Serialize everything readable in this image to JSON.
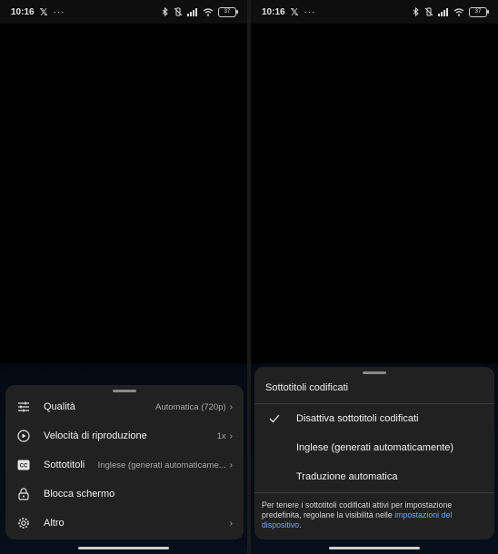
{
  "status": {
    "time": "10:16",
    "x_glyph": "𝕏",
    "dots": "···",
    "battery": "37"
  },
  "left_menu": {
    "items": [
      {
        "label": "Qualità",
        "value": "Automatica (720p)",
        "chevron": "›",
        "icon": "tune-icon"
      },
      {
        "label": "Velocità di riproduzione",
        "value": "1x",
        "chevron": "›",
        "icon": "playback-speed-icon"
      },
      {
        "label": "Sottotitoli",
        "value": "Inglese (generati automaticame...",
        "chevron": "›",
        "icon": "closed-captions-icon"
      },
      {
        "label": "Blocca schermo",
        "value": "",
        "chevron": "",
        "icon": "lock-icon"
      },
      {
        "label": "Altro",
        "value": "",
        "chevron": "›",
        "icon": "gear-icon"
      }
    ]
  },
  "right_menu": {
    "title": "Sottotitoli codificati",
    "options": [
      {
        "label": "Disattiva sottotitoli codificati",
        "selected": true
      },
      {
        "label": "Inglese (generati automaticamente)",
        "selected": false
      },
      {
        "label": "Traduzione automatica",
        "selected": false
      }
    ],
    "footer_text": "Per tenere i sottotitoli codificati attivi per impostazione predefinita, regolane la visibilità nelle ",
    "footer_link": "impostazioni del dispositivo",
    "footer_end": "."
  },
  "colors": {
    "sheet": "#212121",
    "link": "#6fa8ff",
    "text": "#f1f1f1",
    "muted": "#aaaaaa"
  }
}
